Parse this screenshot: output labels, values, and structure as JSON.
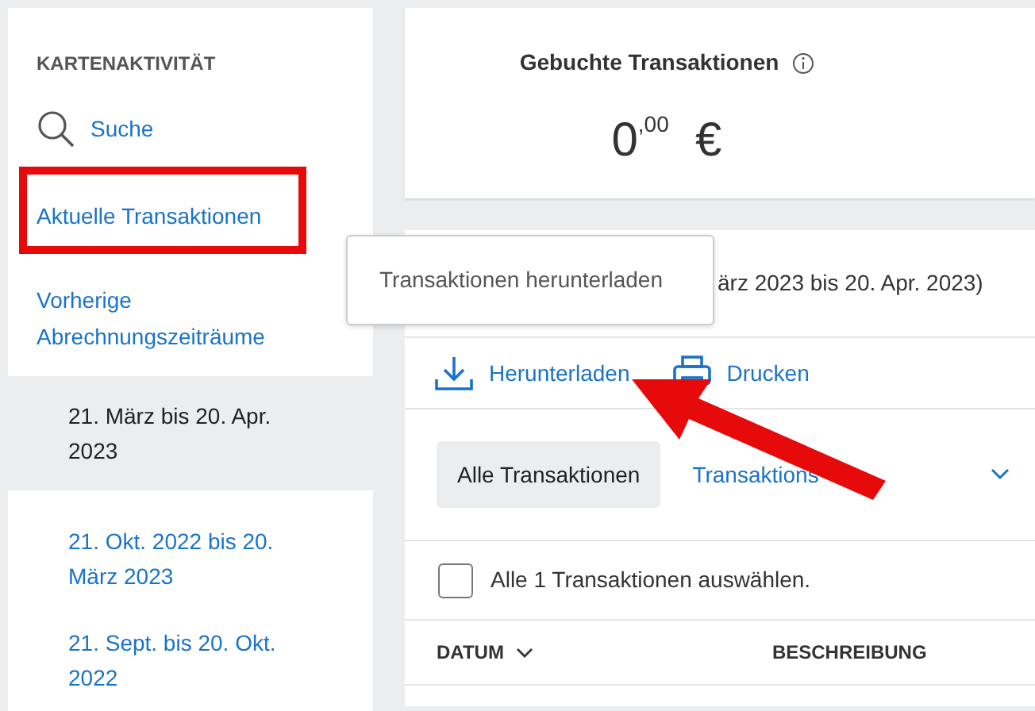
{
  "sidebar": {
    "heading": "KARTENAKTIVITÄT",
    "search": "Suche",
    "items": [
      {
        "label": "Aktuelle Transaktionen",
        "selected": false,
        "highlighted": true
      },
      {
        "label": "Vorherige Abrechnungszeiträume",
        "selected": false,
        "highlighted": false
      }
    ],
    "periods": [
      {
        "label": "21. März bis 20. Apr. 2023",
        "selected": true
      },
      {
        "label": "21. Okt. 2022 bis 20. März 2023",
        "selected": false
      },
      {
        "label": "21. Sept. bis 20. Okt. 2022",
        "selected": false
      }
    ]
  },
  "summary": {
    "title": "Gebuchte Transaktionen",
    "amount_whole": "0",
    "amount_cents": ",00",
    "currency": "€"
  },
  "transactions": {
    "period": "ärz 2023 bis 20. Apr. 2023)",
    "tooltip": "Transaktionen herunterladen",
    "actions": [
      {
        "kind": "download",
        "label": "Herunterladen"
      },
      {
        "kind": "print",
        "label": "Drucken"
      }
    ],
    "filters": [
      {
        "kind": "button",
        "label": "Alle Transaktionen",
        "selected": true
      },
      {
        "kind": "dropdown",
        "label": "Transaktions",
        "selected": false
      }
    ],
    "select_all": {
      "label": "Alle 1 Transaktionen auswählen.",
      "checked": false
    },
    "columns": [
      {
        "label": "DATUM",
        "sortable": true
      },
      {
        "label": "BESCHREIBUNG",
        "sortable": false
      }
    ]
  },
  "annotation_arrow": true
}
